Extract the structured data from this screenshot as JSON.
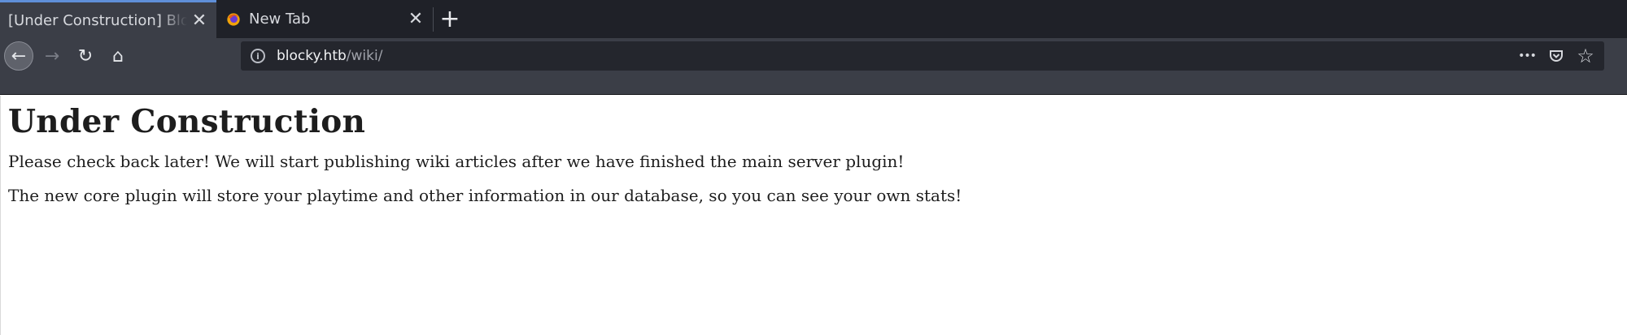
{
  "browser": {
    "tabs": [
      {
        "title": "[Under Construction] Blocky",
        "active": true,
        "close": "✕"
      },
      {
        "title": "New Tab",
        "active": false,
        "close": "✕"
      }
    ],
    "new_tab": "+",
    "nav": {
      "back": "←",
      "forward": "→",
      "reload": "↻",
      "home": "⌂"
    },
    "url": {
      "host": "blocky.htb",
      "path": "/wiki/"
    },
    "url_actions": {
      "more": "•••",
      "pocket": "pocket-icon",
      "bookmark": "☆"
    },
    "colors": {
      "tab_accent": "#5f8fd8",
      "chrome": "#3b3e47",
      "tabstrip": "#1f2128",
      "urlbar": "#24262d"
    }
  },
  "page": {
    "heading": "Under Construction",
    "paragraphs": [
      "Please check back later! We will start publishing wiki articles after we have finished the main server plugin!",
      "The new core plugin will store your playtime and other information in our database, so you can see your own stats!"
    ]
  }
}
